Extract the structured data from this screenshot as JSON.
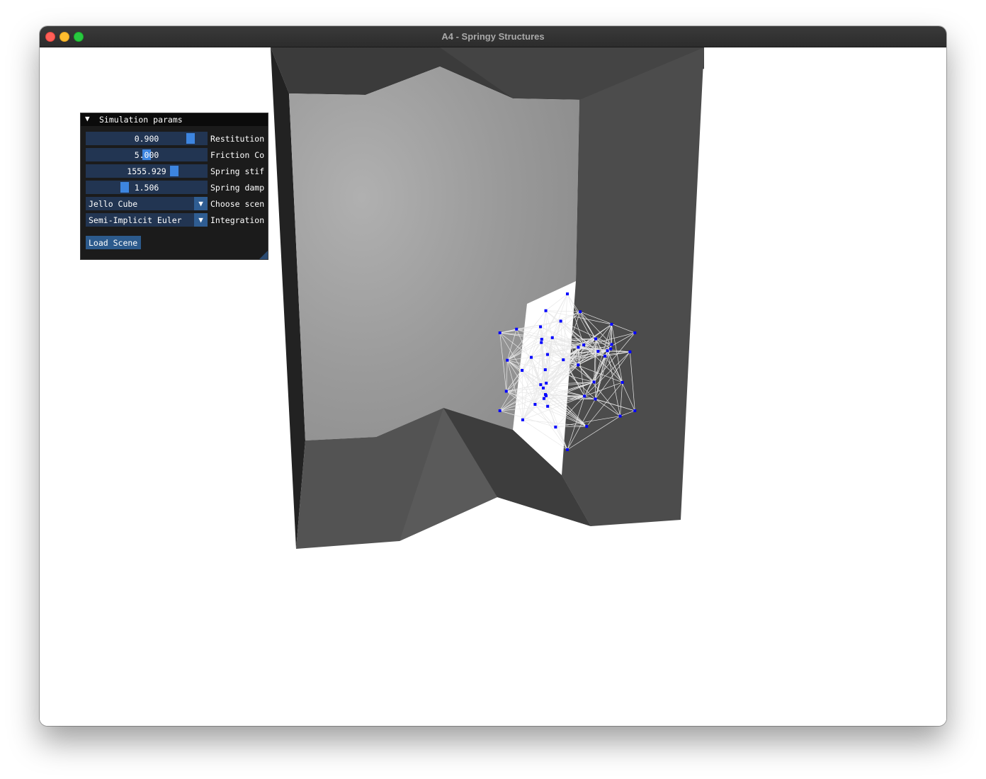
{
  "window": {
    "title": "A4 - Springy Structures"
  },
  "panel": {
    "title": "Simulation params",
    "sliders": [
      {
        "value": "0.900",
        "label": "Restitution",
        "level": 0.9
      },
      {
        "value": "5.000",
        "label": "Friction Co",
        "level": 0.5
      },
      {
        "value": "1555.929",
        "label": "Spring stif",
        "level": 0.75
      },
      {
        "value": "1.506",
        "label": "Spring damp",
        "level": 0.3
      }
    ],
    "scene_combo": {
      "value": "Jello Cube",
      "label": "Choose scen"
    },
    "integration_combo": {
      "value": "Semi-Implicit Euler",
      "label": "Integration"
    },
    "load_button": "Load Scene"
  },
  "colors": {
    "titlebar": "#2c2c2c",
    "panel_bg": "#1b1b1b",
    "widget_bg": "#223552",
    "slider_grab": "#3d85e0",
    "button": "#2c5a8c",
    "mesh_edges": "#e8e8e8",
    "mesh_nodes": "#0000ff"
  },
  "icons": {
    "collapse": "triangle-down-icon",
    "combo_arrow": "triangle-down-icon"
  }
}
